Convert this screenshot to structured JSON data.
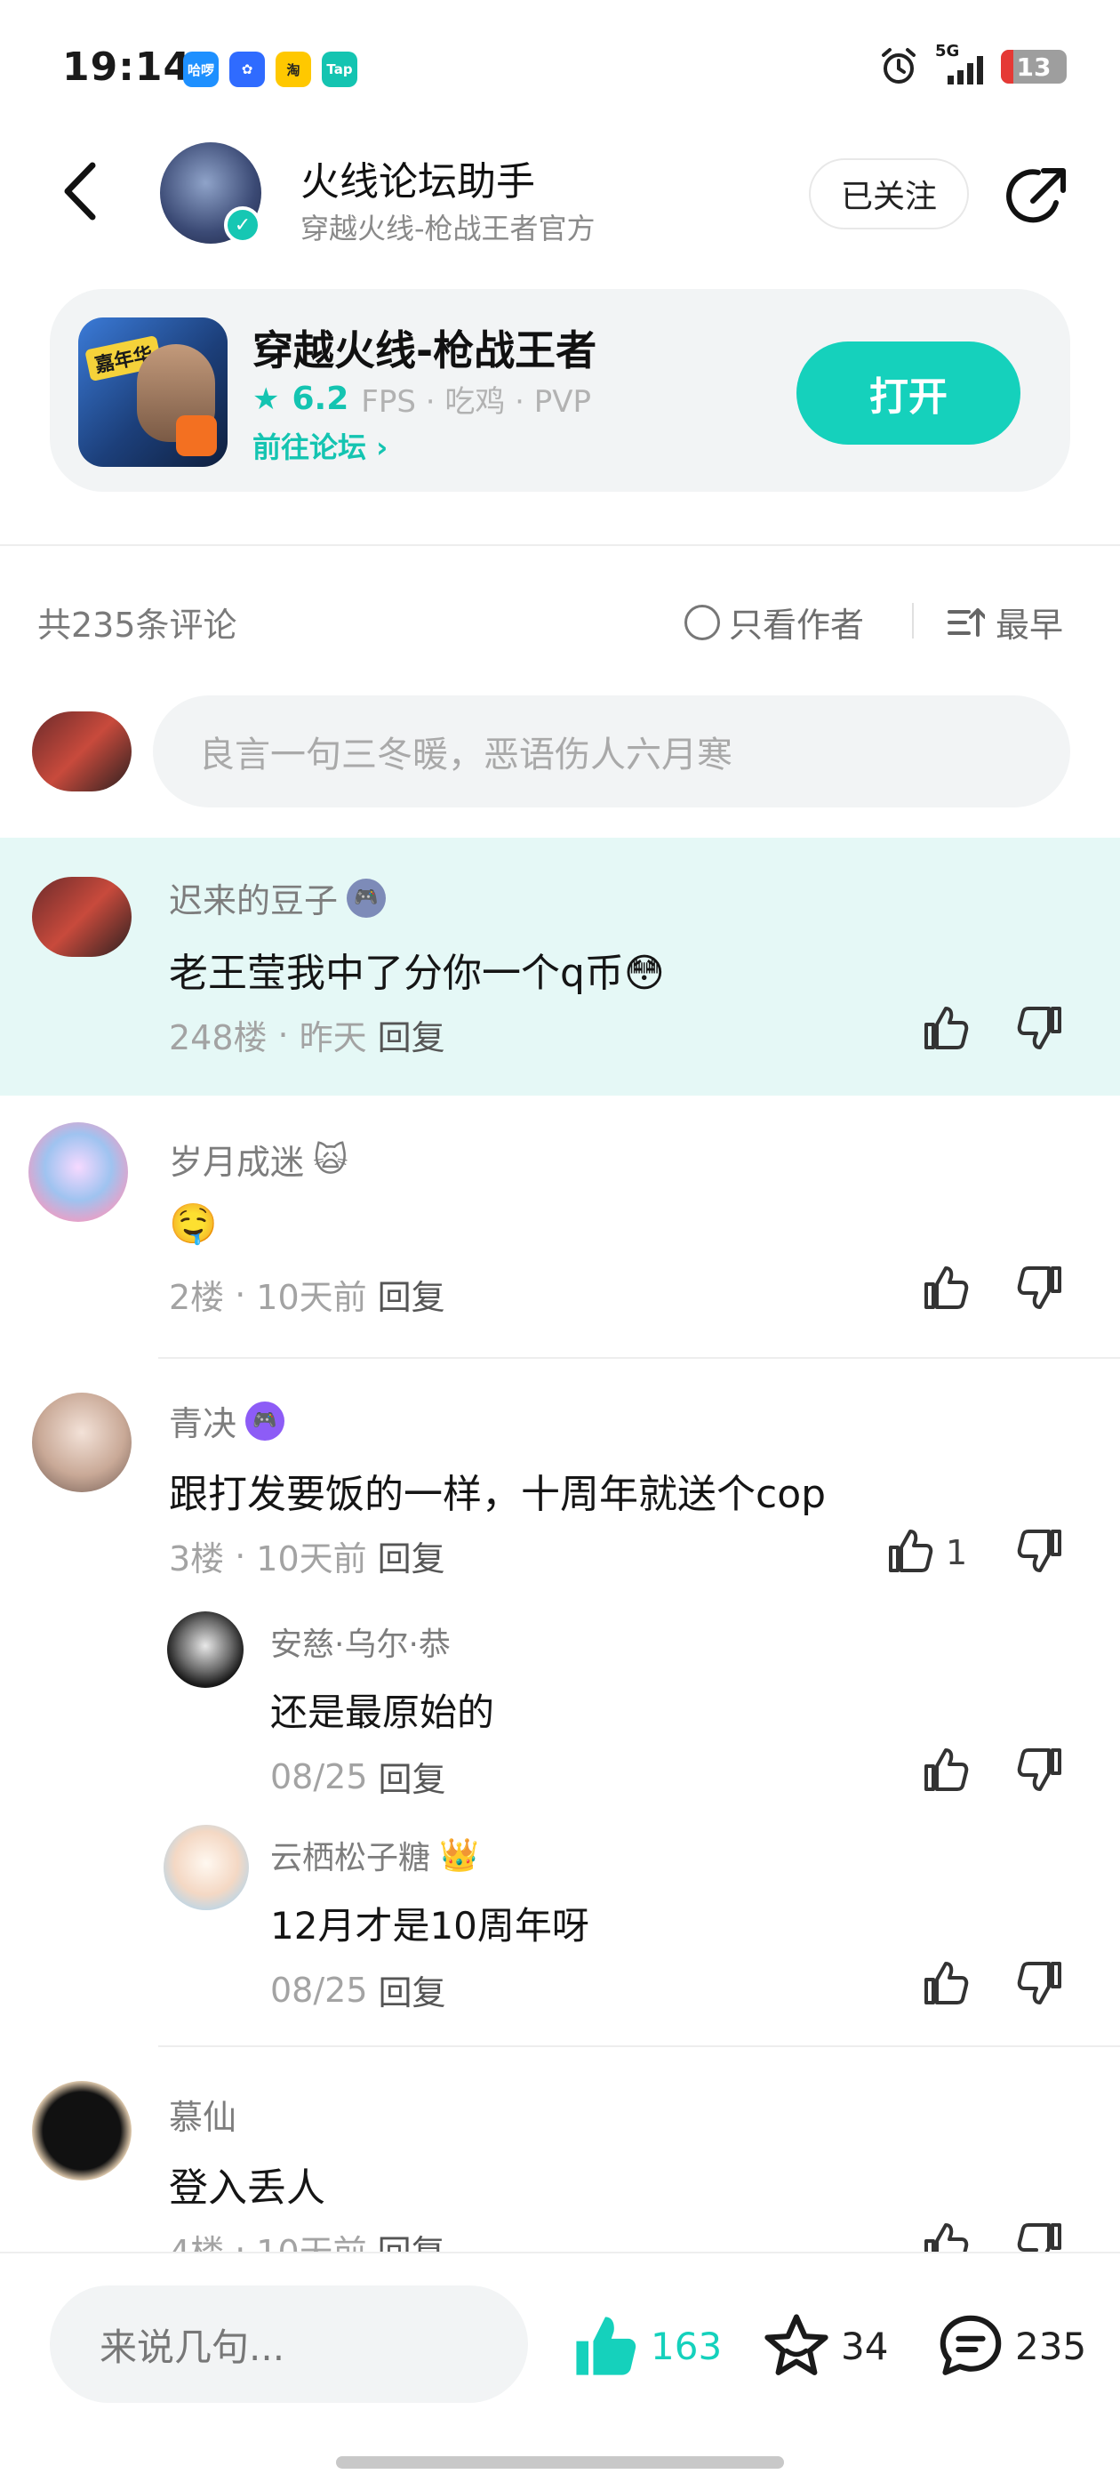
{
  "status_bar": {
    "time": "19:14",
    "apps": [
      {
        "name": "hallo-app-icon",
        "label": "哈啰",
        "color": "#1e90ff"
      },
      {
        "name": "baidu-app-icon",
        "label": "✿",
        "color": "#2f6bff"
      },
      {
        "name": "taobao-app-icon",
        "label": "淘",
        "color": "#ffc800"
      },
      {
        "name": "taptap-app-icon",
        "label": "Tap",
        "color": "#14c4b1"
      }
    ],
    "network": "5G",
    "battery": "13"
  },
  "header": {
    "name": "火线论坛助手",
    "subtitle": "穿越火线-枪战王者官方",
    "follow_label": "已关注"
  },
  "game_card": {
    "title": "穿越火线-枪战王者",
    "score": "6.2",
    "tags": "FPS · 吃鸡 · PVP",
    "forum_link": "前往论坛",
    "open_label": "打开",
    "icon_badge": "嘉年华"
  },
  "comments_header": {
    "count_text": "共235条评论",
    "author_only": "只看作者",
    "sort_label": "最早"
  },
  "input": {
    "placeholder": "良言一句三冬暖，恶语伤人六月寒"
  },
  "comments": [
    {
      "user": "迟来的豆子",
      "text": "老王莹我中了分你一个q币😳",
      "floor": "248楼",
      "time": "昨天",
      "reply": "回复",
      "likes": ""
    },
    {
      "user": "岁月成迷",
      "text": "🤤",
      "floor": "2楼",
      "time": "10天前",
      "reply": "回复",
      "likes": ""
    },
    {
      "user": "青决",
      "text": "跟打发要饭的一样，十周年就送个cop",
      "floor": "3楼",
      "time": "10天前",
      "reply": "回复",
      "likes": "1"
    },
    {
      "user": "慕仙",
      "text": "登入丢人",
      "floor": "4楼",
      "time": "10天前",
      "reply": "回复",
      "likes": ""
    }
  ],
  "replies": [
    {
      "user": "安慈·乌尔·恭",
      "text": "还是最原始的",
      "date": "08/25",
      "reply": "回复"
    },
    {
      "user": "云栖松子糖",
      "text": "12月才是10周年呀",
      "date": "08/25",
      "reply": "回复"
    }
  ],
  "bottom_bar": {
    "say_placeholder": "来说几句...",
    "likes": "163",
    "favorites": "34",
    "comments": "235"
  },
  "colors": {
    "accent": "#15d1bc",
    "highlight_bg": "#e5f8f6"
  }
}
